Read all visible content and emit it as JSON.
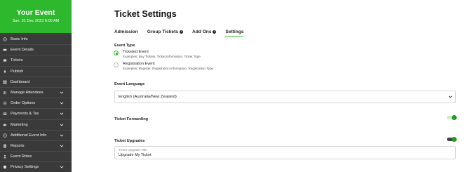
{
  "event": {
    "title": "Your Event",
    "date": "Sun, 31 Dec 2023 6:00 AM",
    "accent_color": "#2eb82e"
  },
  "sidebar": {
    "background_color": "#3a3a3a",
    "items": [
      {
        "label": "Basic Info",
        "icon": "info-icon",
        "expandable": false
      },
      {
        "label": "Event Details",
        "icon": "details-icon",
        "expandable": false
      },
      {
        "label": "Tickets",
        "icon": "ticket-icon",
        "expandable": false
      },
      {
        "label": "Publish",
        "icon": "publish-icon",
        "expandable": false
      },
      {
        "label": "Dashboard",
        "icon": "dashboard-icon",
        "expandable": false
      },
      {
        "label": "Manage Attendees",
        "icon": "attendees-icon",
        "expandable": true
      },
      {
        "label": "Order Options",
        "icon": "gear-icon",
        "expandable": true
      },
      {
        "label": "Payments & Tax",
        "icon": "payments-icon",
        "expandable": true
      },
      {
        "label": "Marketing",
        "icon": "marketing-icon",
        "expandable": true
      },
      {
        "label": "Additional Event Info",
        "icon": "info-icon",
        "expandable": true
      },
      {
        "label": "Reports",
        "icon": "reports-icon",
        "expandable": true
      },
      {
        "label": "Event Roles",
        "icon": "roles-icon",
        "expandable": false
      },
      {
        "label": "Privacy Settings",
        "icon": "privacy-icon",
        "expandable": true
      }
    ]
  },
  "main": {
    "title": "Ticket Settings",
    "tabs": [
      {
        "label": "Admission",
        "info": false,
        "active": false
      },
      {
        "label": "Group Tickets",
        "info": true,
        "active": false
      },
      {
        "label": "Add Ons",
        "info": true,
        "active": false
      },
      {
        "label": "Settings",
        "info": false,
        "active": true
      }
    ],
    "event_type": {
      "label": "Event Type",
      "options": [
        {
          "title": "Ticketed Event",
          "description": "Examples: Buy Tickets, Ticket Information, Ticket Type",
          "selected": true
        },
        {
          "title": "Registration Event",
          "description": "Examples: Register, Registration Information, Registration Type",
          "selected": false
        }
      ]
    },
    "event_language": {
      "label": "Event Language",
      "value": "English (Australia/New Zealand)"
    },
    "ticket_forwarding": {
      "label": "Ticket Forwarding",
      "enabled": true
    },
    "ticket_upgrades": {
      "label": "Ticket Upgrades",
      "enabled": true,
      "field_label": "Ticket Upgrade Title",
      "field_value": "Upgrade My Ticket"
    }
  }
}
